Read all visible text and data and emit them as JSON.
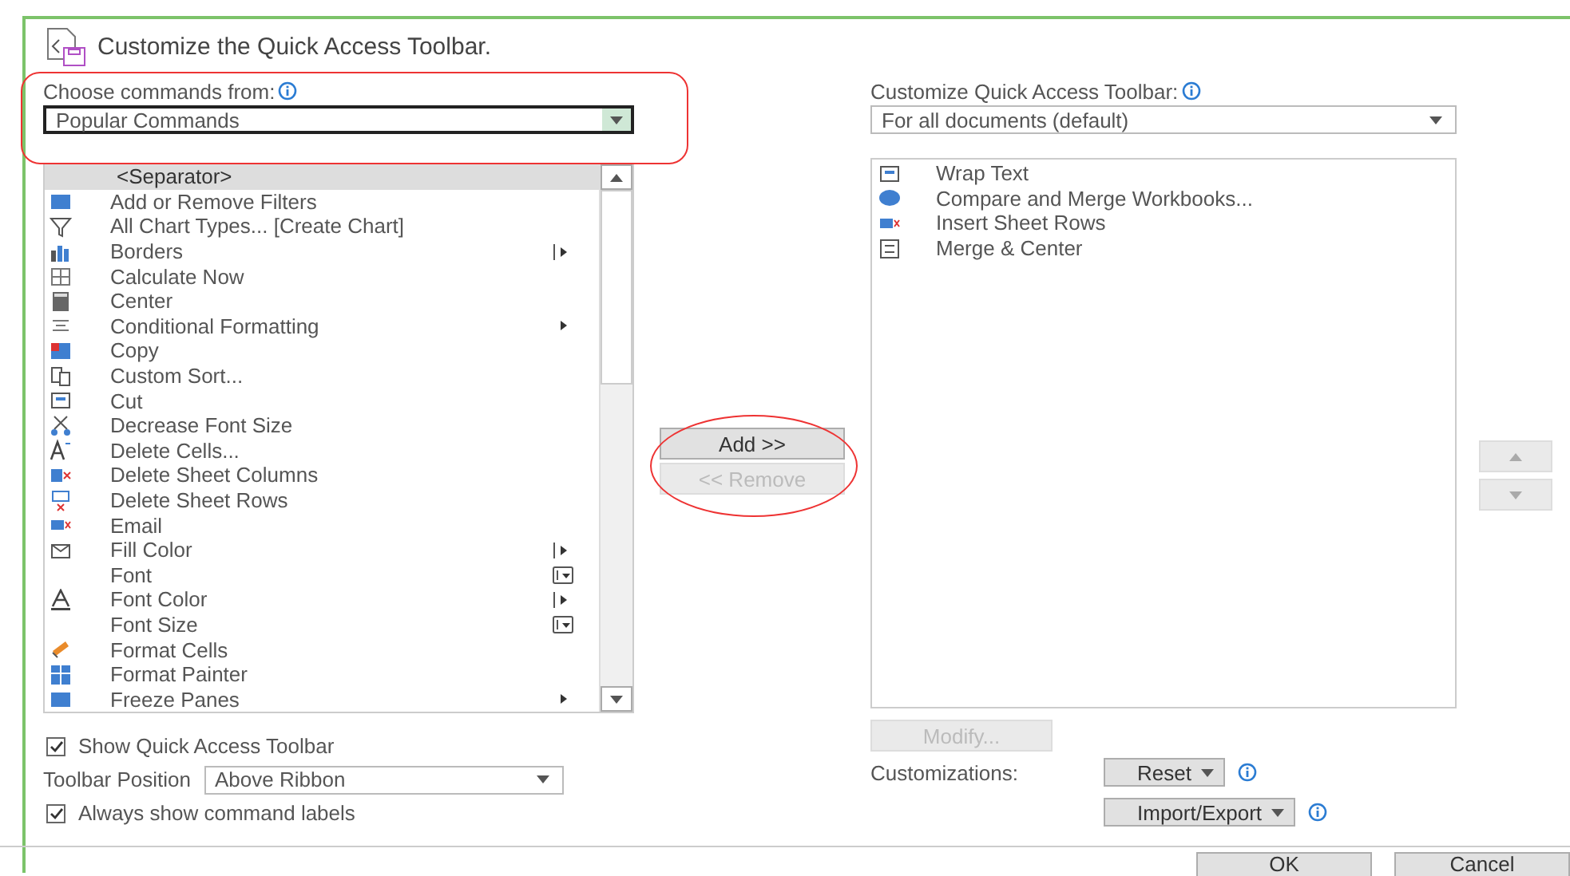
{
  "header": {
    "title": "Customize the Quick Access Toolbar."
  },
  "commands_from": {
    "label": "Choose commands from:",
    "value": "Popular Commands",
    "focused": true
  },
  "commands": [
    {
      "label": "<Separator>",
      "selected": true,
      "has_icon": false,
      "kind": "plain"
    },
    {
      "label": "Add or Remove Filters",
      "selected": false,
      "has_icon": true,
      "kind": "plain"
    },
    {
      "label": "All Chart Types... [Create Chart]",
      "selected": false,
      "has_icon": true,
      "kind": "plain"
    },
    {
      "label": "Borders",
      "selected": false,
      "has_icon": true,
      "kind": "split"
    },
    {
      "label": "Calculate Now",
      "selected": false,
      "has_icon": true,
      "kind": "plain"
    },
    {
      "label": "Center",
      "selected": false,
      "has_icon": true,
      "kind": "plain"
    },
    {
      "label": "Conditional Formatting",
      "selected": false,
      "has_icon": true,
      "kind": "submenu"
    },
    {
      "label": "Copy",
      "selected": false,
      "has_icon": true,
      "kind": "plain"
    },
    {
      "label": "Custom Sort...",
      "selected": false,
      "has_icon": true,
      "kind": "plain"
    },
    {
      "label": "Cut",
      "selected": false,
      "has_icon": true,
      "kind": "plain"
    },
    {
      "label": "Decrease Font Size",
      "selected": false,
      "has_icon": true,
      "kind": "plain"
    },
    {
      "label": "Delete Cells...",
      "selected": false,
      "has_icon": true,
      "kind": "plain"
    },
    {
      "label": "Delete Sheet Columns",
      "selected": false,
      "has_icon": true,
      "kind": "plain"
    },
    {
      "label": "Delete Sheet Rows",
      "selected": false,
      "has_icon": true,
      "kind": "plain"
    },
    {
      "label": "Email",
      "selected": false,
      "has_icon": true,
      "kind": "plain"
    },
    {
      "label": "Fill Color",
      "selected": false,
      "has_icon": true,
      "kind": "split"
    },
    {
      "label": "Font",
      "selected": false,
      "has_icon": false,
      "kind": "combo"
    },
    {
      "label": "Font Color",
      "selected": false,
      "has_icon": true,
      "kind": "split"
    },
    {
      "label": "Font Size",
      "selected": false,
      "has_icon": false,
      "kind": "combo"
    },
    {
      "label": "Format Cells",
      "selected": false,
      "has_icon": true,
      "kind": "plain"
    },
    {
      "label": "Format Painter",
      "selected": false,
      "has_icon": true,
      "kind": "plain"
    },
    {
      "label": "Freeze Panes",
      "selected": false,
      "has_icon": true,
      "kind": "submenu"
    }
  ],
  "add_button": {
    "label": "Add >>",
    "disabled": false
  },
  "remove_button": {
    "label": "<< Remove",
    "disabled": true
  },
  "toolbar_for": {
    "label": "Customize Quick Access Toolbar:",
    "value": "For all documents (default)"
  },
  "toolbar_items": [
    {
      "label": "Wrap Text",
      "selected": false
    },
    {
      "label": "Compare and Merge Workbooks...",
      "selected": false
    },
    {
      "label": "Insert Sheet Rows",
      "selected": false
    },
    {
      "label": "Merge & Center",
      "selected": false
    }
  ],
  "move_up": {
    "disabled": true
  },
  "move_down": {
    "disabled": true
  },
  "show_toolbar": {
    "label": "Show Quick Access Toolbar",
    "checked": true
  },
  "position": {
    "label": "Toolbar Position",
    "value": "Above Ribbon"
  },
  "show_labels": {
    "label": "Always show command labels",
    "checked": true
  },
  "modify_button": {
    "label": "Modify...",
    "disabled": true
  },
  "customizations": {
    "label": "Customizations:",
    "reset": "Reset",
    "import_export": "Import/Export"
  },
  "footer": {
    "ok": "OK",
    "cancel": "Cancel"
  }
}
